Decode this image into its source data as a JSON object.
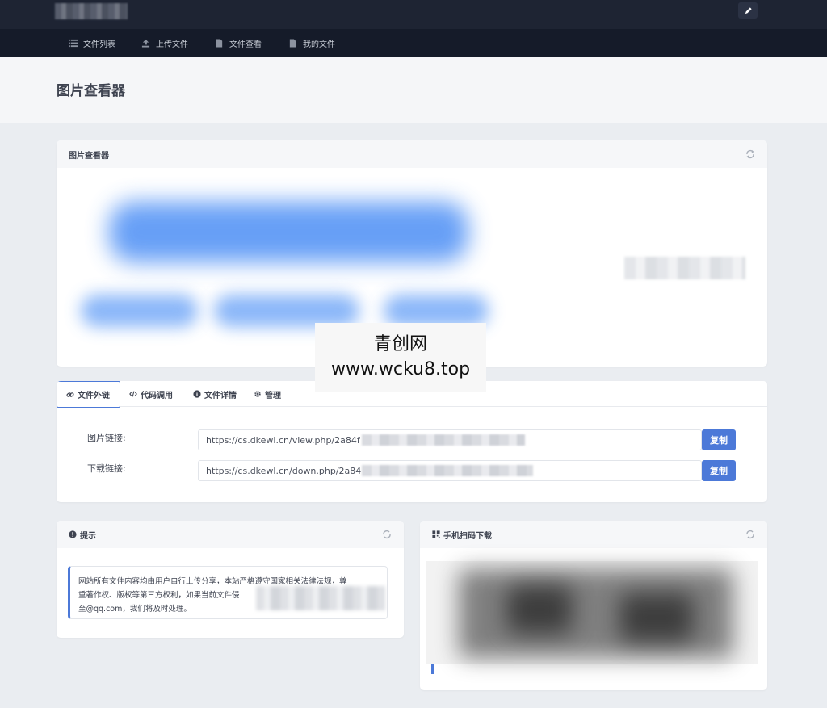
{
  "header": {
    "edit_icon": "pencil-icon",
    "nav": [
      {
        "label": "文件列表",
        "icon": "list-icon"
      },
      {
        "label": "上传文件",
        "icon": "upload-icon"
      },
      {
        "label": "文件查看",
        "icon": "file-icon"
      },
      {
        "label": "我的文件",
        "icon": "file-icon"
      }
    ]
  },
  "page_title": "图片查看器",
  "viewer_card": {
    "title": "图片查看器",
    "refresh_icon": "refresh-icon"
  },
  "watermark": {
    "line1": "青创网",
    "line2": "www.wcku8.top"
  },
  "tabs": [
    {
      "label": "文件外链",
      "icon": "link-icon",
      "active": true
    },
    {
      "label": "代码调用",
      "icon": "code-icon",
      "active": false
    },
    {
      "label": "文件详情",
      "icon": "info-icon",
      "active": false
    },
    {
      "label": "管理",
      "icon": "gear-icon",
      "active": false
    }
  ],
  "links": {
    "image_label": "图片链接:",
    "image_url": "https://cs.dkewl.cn/view.php/2a84f",
    "download_label": "下载链接:",
    "download_url": "https://cs.dkewl.cn/down.php/2a84",
    "copy_label": "复制"
  },
  "tip_card": {
    "title": "提示",
    "text_line1": "网站所有文件内容均由用户自行上传分享，本站严格遵守国家相关法律法规，尊",
    "text_line2": "重著作权、版权等第三方权利，如果当前文件侵",
    "text_line3": "至@qq.com，我们将及时处理。"
  },
  "qr_card": {
    "title": "手机扫码下载",
    "icon": "qrcode-icon"
  },
  "colors": {
    "accent": "#4c79d8",
    "topbar": "#1e2433",
    "navbar": "#151b29"
  }
}
